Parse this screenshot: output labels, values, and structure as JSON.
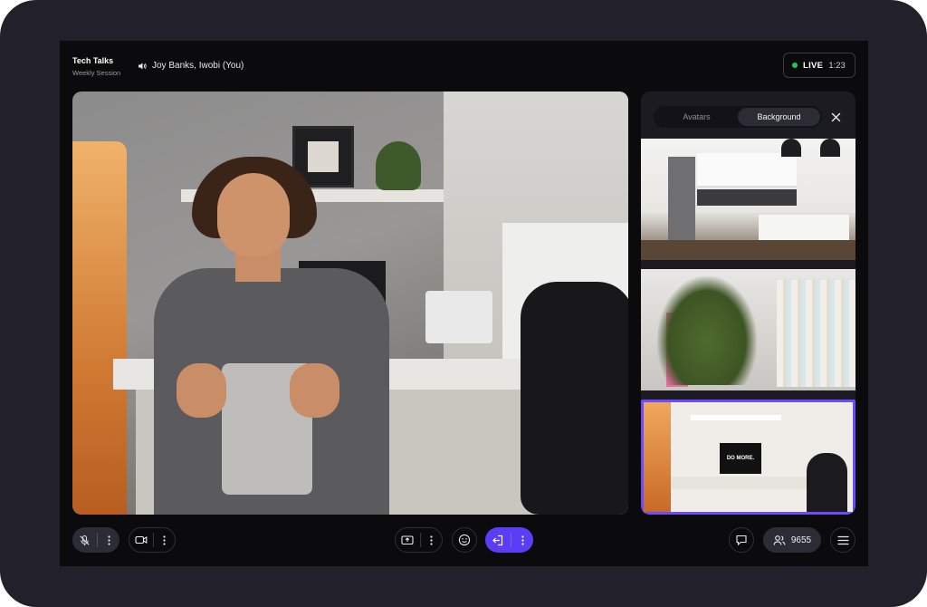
{
  "meeting": {
    "title": "Tech Talks",
    "subtitle": "Weekly Session",
    "speakers": "Joy Banks, Iwobi (You)"
  },
  "live": {
    "label": "LIVE",
    "elapsed": "1:23",
    "status_color": "#22c55e"
  },
  "panel": {
    "tabs": [
      {
        "label": "Avatars",
        "active": false
      },
      {
        "label": "Background",
        "active": true
      }
    ],
    "backgrounds": [
      {
        "name": "kitchen",
        "selected": false
      },
      {
        "name": "clothing-store",
        "selected": false
      },
      {
        "name": "home-office",
        "selected": true,
        "monitor_text": "DO MORE."
      }
    ]
  },
  "controls": {
    "participants_count": "9655",
    "accent_color": "#5b3df5"
  },
  "icons": [
    "speaker-icon",
    "mic-off-icon",
    "camera-icon",
    "share-screen-icon",
    "emoji-icon",
    "leave-icon",
    "chat-icon",
    "people-icon",
    "menu-icon",
    "close-icon",
    "more-icon"
  ]
}
